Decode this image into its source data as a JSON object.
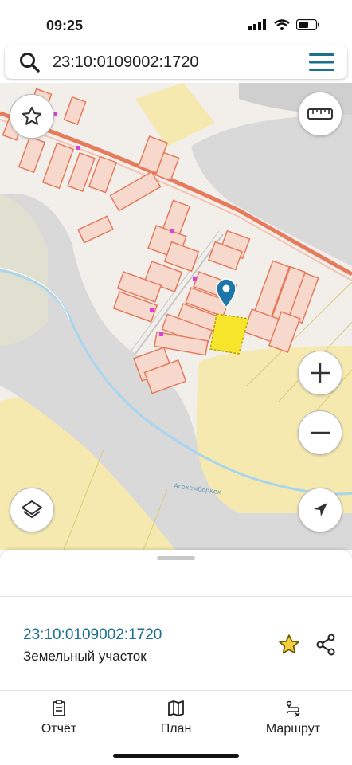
{
  "status_bar": {
    "time": "09:25"
  },
  "search": {
    "value": "23:10:0109002:1720"
  },
  "map": {
    "river_label": "Агохемберкех",
    "colors": {
      "background": "#f2eeea",
      "road": "#d3d3d3",
      "field": "#f5e9b0",
      "parcel_stroke": "#e57a5c",
      "parcel_fill": "#f7d8cc",
      "selected_parcel": "#f6e52a",
      "marker": "#1d76a8",
      "water": "#a9d6ef"
    }
  },
  "map_controls": {
    "favorite": "star-icon",
    "ruler": "ruler-icon",
    "zoom_in": "plus-icon",
    "zoom_out": "minus-icon",
    "layers": "layers-icon",
    "locate": "navigation-arrow-icon"
  },
  "sheet": {
    "cadastral_number": "23:10:0109002:1720",
    "object_type": "Земельный участок"
  },
  "tabs": [
    {
      "label": "Отчёт",
      "icon": "report-icon"
    },
    {
      "label": "План",
      "icon": "map-plan-icon"
    },
    {
      "label": "Маршрут",
      "icon": "route-icon"
    }
  ]
}
